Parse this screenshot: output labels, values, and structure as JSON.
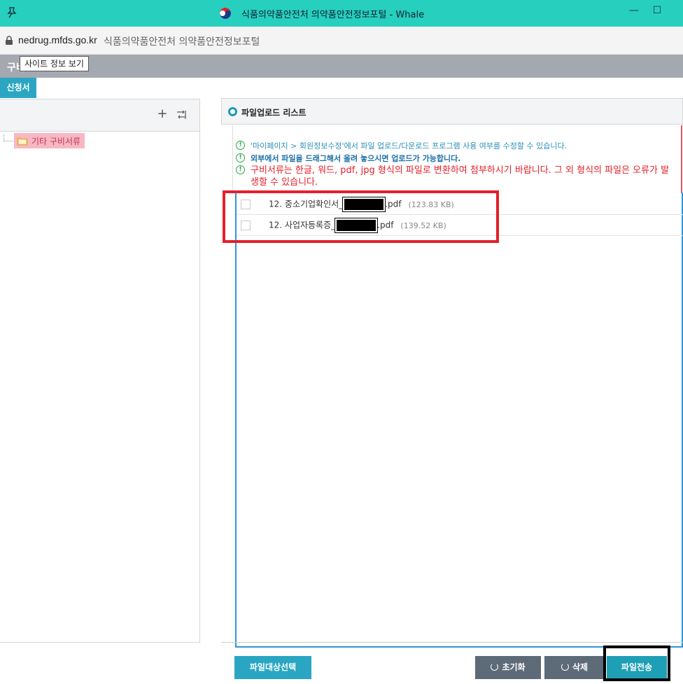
{
  "window": {
    "title": "식품의약품안전처 의약품안전정보포털 - Whale",
    "minimize": "—",
    "maximize": "☐"
  },
  "address": {
    "url": "nedrug.mfds.go.kr",
    "page_title": "식품의약품안전처 의약품안전정보포털"
  },
  "header": {
    "band_text": "구비",
    "tooltip": "사이트 정보 보기",
    "tab_label": "신청서"
  },
  "tree": {
    "add": "+",
    "item_label": "기타 구비서류"
  },
  "upload": {
    "title": "파일업로드 리스트",
    "notices": [
      "'마이페이지 > 회원정보수정'에서 파일 업로드/다운로드 프로그램 사용 여부를 수정할 수 있습니다.",
      "외부에서 파일을 드래그해서 올려 놓으시면 업로드가 가능합니다.",
      "구비서류는 한글, 워드, pdf, jpg 형식의 파일로 변환하여 첨부하시기 바랍니다. 그 외 형식의 파일은 오류가 발생할 수 있습니다."
    ],
    "notice_mark": "!",
    "files": [
      {
        "prefix": "12. 중소기업확인서_",
        "suffix": ".pdf",
        "size": "(123.83 KB)"
      },
      {
        "prefix": "12. 사업자등록증_",
        "suffix": ".pdf",
        "size": "(139.52 KB)"
      }
    ]
  },
  "buttons": {
    "select": "파일대상선택",
    "reset": "초기화",
    "delete": "삭제",
    "send": "파일전송"
  },
  "colors": {
    "titlebar": "#26cfbe",
    "accent": "#2aa6c3",
    "notice_red": "#e3202a",
    "highlight_red": "#e3202a",
    "button_gray": "#5d6a78"
  }
}
